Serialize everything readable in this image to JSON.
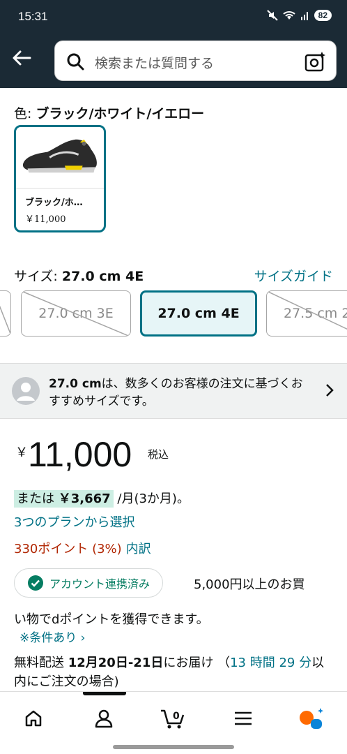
{
  "status_bar": {
    "time": "15:31",
    "battery": "82",
    "icons": [
      "mute-icon",
      "wifi-icon",
      "signal-icon",
      "battery-icon"
    ]
  },
  "search": {
    "placeholder": "検索または質問する"
  },
  "product": {
    "color_label": "色: ",
    "color_value": "ブラック/ホワイト/イエロー",
    "swatch_name": "ブラック/ホ…",
    "swatch_price": "￥11,000",
    "size_label": "サイズ: ",
    "size_value": "27.0 cm 4E",
    "size_guide": "サイズガイド",
    "sizes": [
      {
        "label": "",
        "available": false
      },
      {
        "label": "27.0 cm 3E",
        "available": false
      },
      {
        "label": "27.0 cm 4E",
        "available": true,
        "selected": true
      },
      {
        "label": "27.5 cm 2",
        "available": false
      }
    ]
  },
  "notice": {
    "bold": "27.0 cm",
    "text": "は、数多くのお客様の注文に基づくおすすめサイズです。"
  },
  "price": {
    "currency": "￥",
    "amount": "11,000",
    "tax": "税込"
  },
  "installment": {
    "prefix": "または ",
    "amount": "￥3,667",
    "suffix": " /月(3か月)。"
  },
  "plans_link": "3つのプランから選択",
  "points": {
    "value": "330ポイント (3%)",
    "detail": "内訳"
  },
  "dpoint": {
    "badge": "アカウント連携済み",
    "line1": "5,000円以上のお買",
    "line2": "い物でdポイントを獲得できます。",
    "conditions": "※条件あり ›"
  },
  "delivery": {
    "prefix": "無料配送 ",
    "date": "12月20日-21日",
    "middle": "にお届け （",
    "countdown": "13 時間 29 分",
    "suffix": "以内にご注文の場合)"
  },
  "colors": {
    "header": "#1b2a35",
    "teal": "#007185",
    "price_red": "#b12704",
    "green": "#067d62"
  }
}
